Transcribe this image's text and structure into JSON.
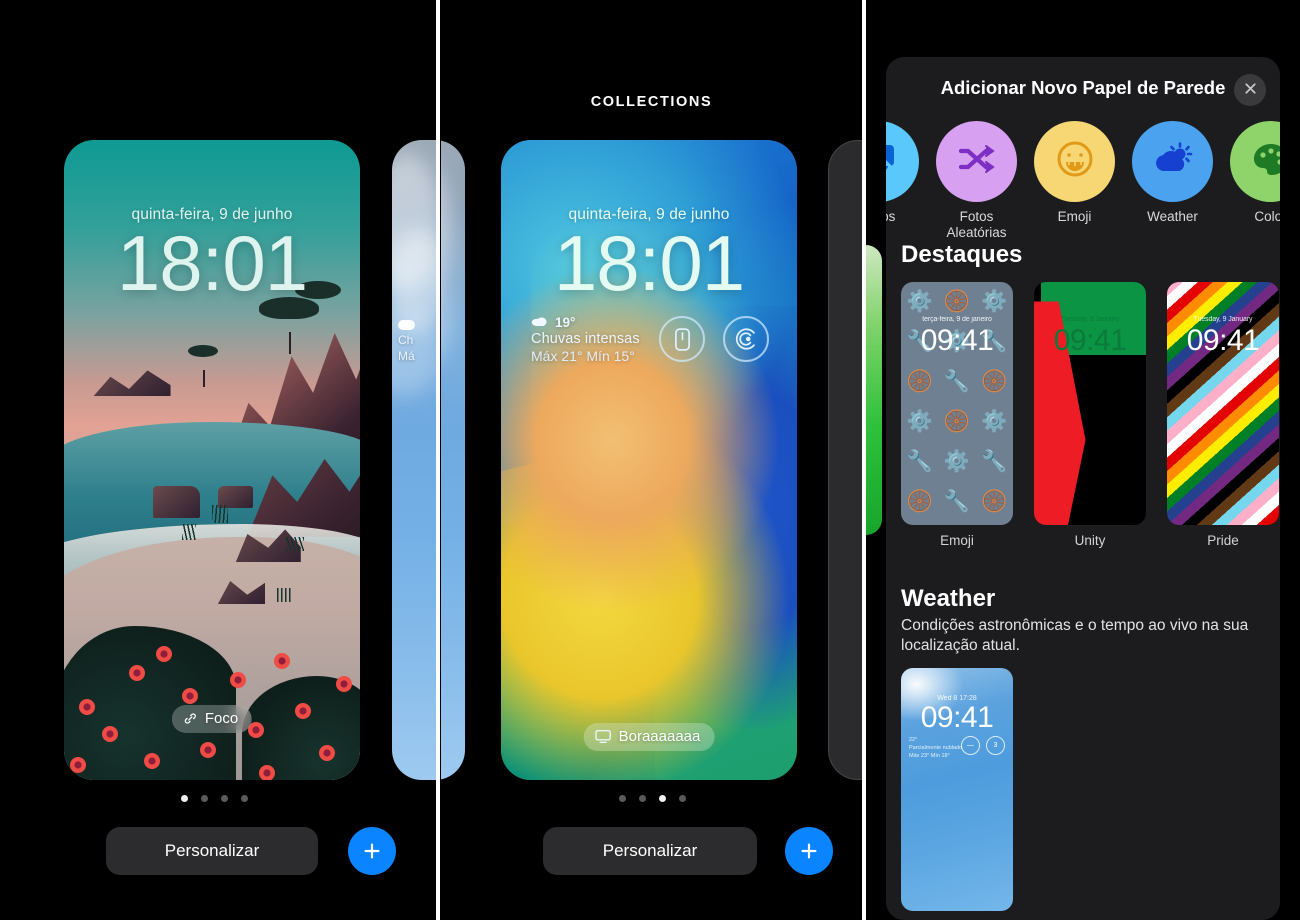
{
  "dividers": {
    "color": "#ffffff"
  },
  "panel_left": {
    "name": "lock-screen-gallery-coastal",
    "lockscreen": {
      "date": "quinta-feira, 9 de junho",
      "time": "18:01",
      "focus_pill": {
        "label": "Foco",
        "icon": "link-icon"
      }
    },
    "page_dots": {
      "count": 4,
      "active_index": 0
    },
    "customize_label": "Personalizar",
    "add_label": "+"
  },
  "panel_mid": {
    "section_title": "COLLECTIONS",
    "lockscreen": {
      "date": "quinta-feira, 9 de junho",
      "time": "18:01",
      "weather": {
        "temp": "19°",
        "condition": "Chuvas intensas",
        "range": "Máx 21° Mín 15°",
        "icon": "cloud-icon"
      },
      "widgets": [
        {
          "name": "remote-icon"
        },
        {
          "name": "sleep-icon"
        }
      ],
      "pill": {
        "label": "Boraaaaaaa",
        "icon": "display-icon"
      }
    },
    "page_dots": {
      "count": 4,
      "active_index": 2
    },
    "customize_label": "Personalizar",
    "add_label": "+"
  },
  "panel_right": {
    "sheet": {
      "title": "Adicionar Novo Papel de Parede",
      "close_icon": "close-icon",
      "categories": [
        {
          "label": "Fotos",
          "icon": "photos-icon",
          "bg": "#5ac8fa",
          "fg": "#0a63d6",
          "partial": true
        },
        {
          "label": "Fotos Aleatórias",
          "icon": "shuffle-icon",
          "bg": "#d8a0f0",
          "fg": "#7d2ec4"
        },
        {
          "label": "Emoji",
          "icon": "emoji-icon",
          "bg": "#f7d774",
          "fg": "#e09a18"
        },
        {
          "label": "Weather",
          "icon": "weather-icon",
          "bg": "#4ba3f0",
          "fg": "#1540d0"
        },
        {
          "label": "Color",
          "icon": "palette-icon",
          "bg": "#8ed46a",
          "fg": "#1e7a24"
        }
      ],
      "sections": [
        {
          "title": "Destaques",
          "items": [
            {
              "label": "Emoji",
              "kind": "emoji",
              "time": "09:41",
              "date": "terça-feira, 9 de janeiro"
            },
            {
              "label": "Unity",
              "kind": "unity",
              "time": "09:41",
              "date": "Tuesday, 9 January"
            },
            {
              "label": "Pride",
              "kind": "pride",
              "time": "09:41",
              "date": "Tuesday, 9 January"
            }
          ]
        },
        {
          "title": "Weather",
          "subtitle": "Condições astronômicas e o tempo ao vivo na sua localização atual.",
          "preview": {
            "time": "09:41",
            "status": "Wed 8   17:28",
            "info_lines": [
              "22°",
              "Parcialmente nublado",
              "Máx 23° Mín 18°"
            ],
            "circle_1": "—",
            "circle_2": "3"
          }
        }
      ]
    }
  }
}
